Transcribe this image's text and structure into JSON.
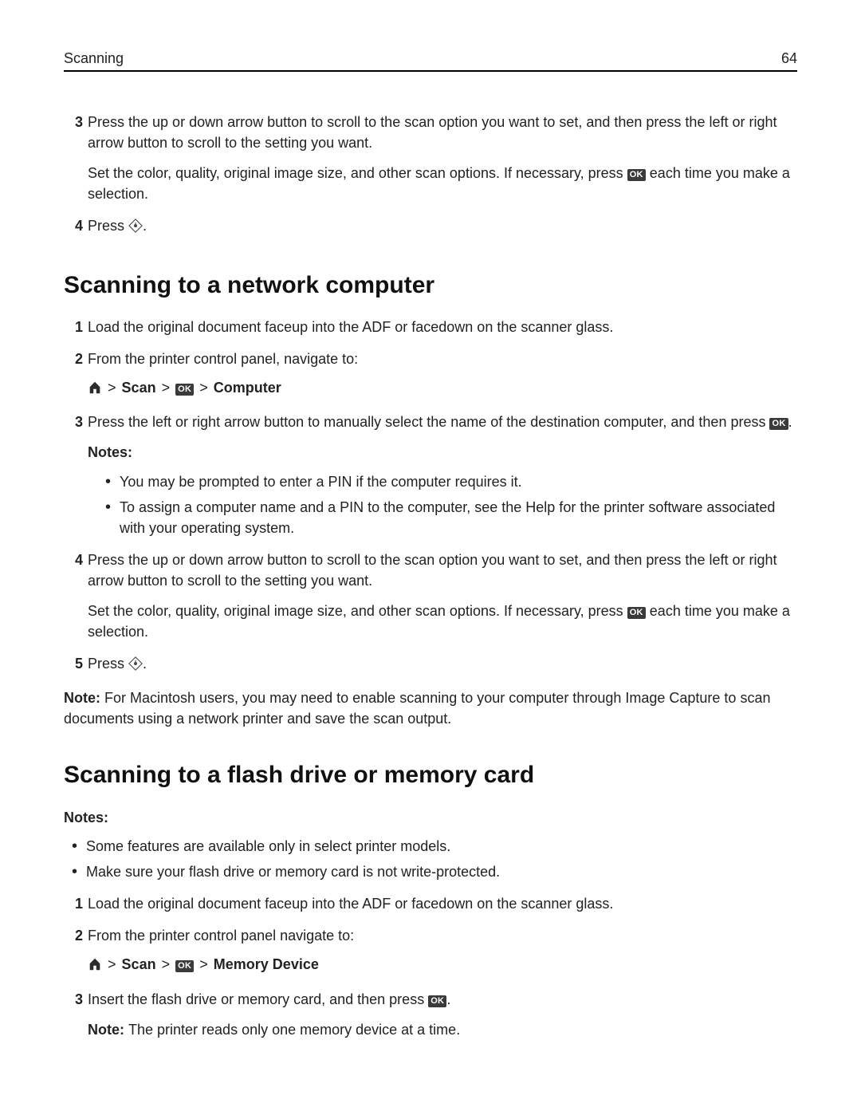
{
  "header": {
    "section": "Scanning",
    "page": "64"
  },
  "intro_steps": {
    "s3": {
      "n": "3",
      "text": "Press the up or down arrow button to scroll to the scan option you want to set, and then press the left or right arrow button to scroll to the setting you want.",
      "sub_a": "Set the color, quality, original image size, and other scan options. If necessary, press ",
      "sub_b": " each time you make a selection."
    },
    "s4": {
      "n": "4",
      "a": "Press ",
      "b": "."
    }
  },
  "sec_net": {
    "title": "Scanning to a network computer",
    "s1": {
      "n": "1",
      "text": "Load the original document faceup into the ADF or facedown on the scanner glass."
    },
    "s2": {
      "n": "2",
      "text": "From the printer control panel, navigate to:",
      "crumb_scan": "Scan",
      "crumb_dest": "Computer"
    },
    "s3": {
      "n": "3",
      "a": "Press the left or right arrow button to manually select the name of the destination computer, and then press ",
      "b": ".",
      "notes_label": "Notes:",
      "note1": "You may be prompted to enter a PIN if the computer requires it.",
      "note2": "To assign a computer name and a PIN to the computer, see the Help for the printer software associated with your operating system."
    },
    "s4": {
      "n": "4",
      "text": "Press the up or down arrow button to scroll to the scan option you want to set, and then press the left or right arrow button to scroll to the setting you want.",
      "sub_a": "Set the color, quality, original image size, and other scan options. If necessary, press ",
      "sub_b": " each time you make a selection."
    },
    "s5": {
      "n": "5",
      "a": "Press ",
      "b": "."
    },
    "footnote_lead": "Note: ",
    "footnote": "For Macintosh users, you may need to enable scanning to your computer through Image Capture to scan documents using a network printer and save the scan output."
  },
  "sec_flash": {
    "title": "Scanning to a flash drive or memory card",
    "notes_label": "Notes:",
    "note1": "Some features are available only in select printer models.",
    "note2": "Make sure your flash drive or memory card is not write‑protected.",
    "s1": {
      "n": "1",
      "text": "Load the original document faceup into the ADF or facedown on the scanner glass."
    },
    "s2": {
      "n": "2",
      "text": "From the printer control panel navigate to:",
      "crumb_scan": "Scan",
      "crumb_dest": "Memory Device"
    },
    "s3": {
      "n": "3",
      "a": "Insert the flash drive or memory card, and then press ",
      "b": ".",
      "note_lead": "Note: ",
      "note": "The printer reads only one memory device at a time."
    }
  },
  "icons": {
    "ok_label": "OK"
  }
}
